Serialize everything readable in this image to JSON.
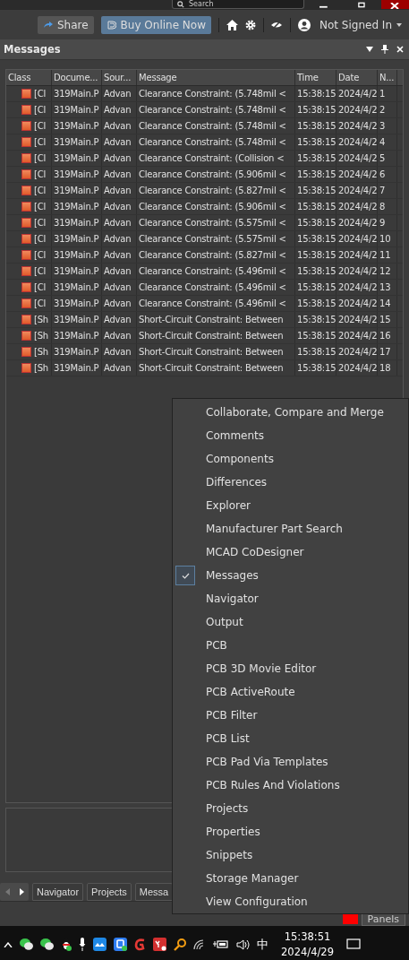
{
  "title_bar": {
    "search": {
      "placeholder": "Search"
    }
  },
  "toolbar": {
    "share": "Share",
    "buy": "Buy Online Now",
    "account": "Not Signed In"
  },
  "panel": {
    "title": "Messages",
    "columns": [
      "Class",
      "Docume...",
      "Sour...",
      "Message",
      "Time",
      "Date",
      "N..."
    ],
    "rows": [
      {
        "class": "[Cl",
        "document": "319Main.P",
        "source": "Advan",
        "message": "Clearance Constraint: (5.748mil <",
        "time": "15:38:15",
        "date": "2024/4/2",
        "n": "1"
      },
      {
        "class": "[Cl",
        "document": "319Main.P",
        "source": "Advan",
        "message": "Clearance Constraint: (5.748mil <",
        "time": "15:38:15",
        "date": "2024/4/2",
        "n": "2"
      },
      {
        "class": "[Cl",
        "document": "319Main.P",
        "source": "Advan",
        "message": "Clearance Constraint: (5.748mil <",
        "time": "15:38:15",
        "date": "2024/4/2",
        "n": "3"
      },
      {
        "class": "[Cl",
        "document": "319Main.P",
        "source": "Advan",
        "message": "Clearance Constraint: (5.748mil <",
        "time": "15:38:15",
        "date": "2024/4/2",
        "n": "4"
      },
      {
        "class": "[Cl",
        "document": "319Main.P",
        "source": "Advan",
        "message": "Clearance Constraint: (Collision <",
        "time": "15:38:15",
        "date": "2024/4/2",
        "n": "5"
      },
      {
        "class": "[Cl",
        "document": "319Main.P",
        "source": "Advan",
        "message": "Clearance Constraint: (5.906mil <",
        "time": "15:38:15",
        "date": "2024/4/2",
        "n": "6"
      },
      {
        "class": "[Cl",
        "document": "319Main.P",
        "source": "Advan",
        "message": "Clearance Constraint: (5.827mil <",
        "time": "15:38:15",
        "date": "2024/4/2",
        "n": "7"
      },
      {
        "class": "[Cl",
        "document": "319Main.P",
        "source": "Advan",
        "message": "Clearance Constraint: (5.906mil <",
        "time": "15:38:15",
        "date": "2024/4/2",
        "n": "8"
      },
      {
        "class": "[Cl",
        "document": "319Main.P",
        "source": "Advan",
        "message": "Clearance Constraint: (5.575mil <",
        "time": "15:38:15",
        "date": "2024/4/2",
        "n": "9"
      },
      {
        "class": "[Cl",
        "document": "319Main.P",
        "source": "Advan",
        "message": "Clearance Constraint: (5.575mil <",
        "time": "15:38:15",
        "date": "2024/4/2",
        "n": "10"
      },
      {
        "class": "[Cl",
        "document": "319Main.P",
        "source": "Advan",
        "message": "Clearance Constraint: (5.827mil <",
        "time": "15:38:15",
        "date": "2024/4/2",
        "n": "11"
      },
      {
        "class": "[Cl",
        "document": "319Main.P",
        "source": "Advan",
        "message": "Clearance Constraint: (5.496mil <",
        "time": "15:38:15",
        "date": "2024/4/2",
        "n": "12"
      },
      {
        "class": "[Cl",
        "document": "319Main.P",
        "source": "Advan",
        "message": "Clearance Constraint: (5.496mil <",
        "time": "15:38:15",
        "date": "2024/4/2",
        "n": "13"
      },
      {
        "class": "[Cl",
        "document": "319Main.P",
        "source": "Advan",
        "message": "Clearance Constraint: (5.496mil <",
        "time": "15:38:15",
        "date": "2024/4/2",
        "n": "14"
      },
      {
        "class": "[Sh",
        "document": "319Main.P",
        "source": "Advan",
        "message": "Short-Circuit Constraint: Between",
        "time": "15:38:15",
        "date": "2024/4/2",
        "n": "15"
      },
      {
        "class": "[Sh",
        "document": "319Main.P",
        "source": "Advan",
        "message": "Short-Circuit Constraint: Between",
        "time": "15:38:15",
        "date": "2024/4/2",
        "n": "16"
      },
      {
        "class": "[Sh",
        "document": "319Main.P",
        "source": "Advan",
        "message": "Short-Circuit Constraint: Between",
        "time": "15:38:15",
        "date": "2024/4/2",
        "n": "17"
      },
      {
        "class": "[Sh",
        "document": "319Main.P",
        "source": "Advan",
        "message": "Short-Circuit Constraint: Between",
        "time": "15:38:15",
        "date": "2024/4/2",
        "n": "18"
      }
    ]
  },
  "bottom_tabs": [
    "Navigator",
    "Projects",
    "Messa"
  ],
  "panels_button": "Panels",
  "menu": [
    {
      "label": "Collaborate, Compare and Merge",
      "checked": false
    },
    {
      "label": "Comments",
      "checked": false
    },
    {
      "label": "Components",
      "checked": false
    },
    {
      "label": "Differences",
      "checked": false
    },
    {
      "label": "Explorer",
      "checked": false
    },
    {
      "label": "Manufacturer Part Search",
      "checked": false
    },
    {
      "label": "MCAD CoDesigner",
      "checked": false
    },
    {
      "label": "Messages",
      "checked": true
    },
    {
      "label": "Navigator",
      "checked": false
    },
    {
      "label": "Output",
      "checked": false
    },
    {
      "label": "PCB",
      "checked": false
    },
    {
      "label": "PCB 3D Movie Editor",
      "checked": false
    },
    {
      "label": "PCB ActiveRoute",
      "checked": false
    },
    {
      "label": "PCB Filter",
      "checked": false
    },
    {
      "label": "PCB List",
      "checked": false
    },
    {
      "label": "PCB Pad Via Templates",
      "checked": false
    },
    {
      "label": "PCB Rules And Violations",
      "checked": false
    },
    {
      "label": "Projects",
      "checked": false
    },
    {
      "label": "Properties",
      "checked": false
    },
    {
      "label": "Snippets",
      "checked": false
    },
    {
      "label": "Storage Manager",
      "checked": false
    },
    {
      "label": "View Configuration",
      "checked": false
    }
  ],
  "taskbar": {
    "input_method": "中",
    "time": "15:38:51",
    "date": "2024/4/29"
  }
}
